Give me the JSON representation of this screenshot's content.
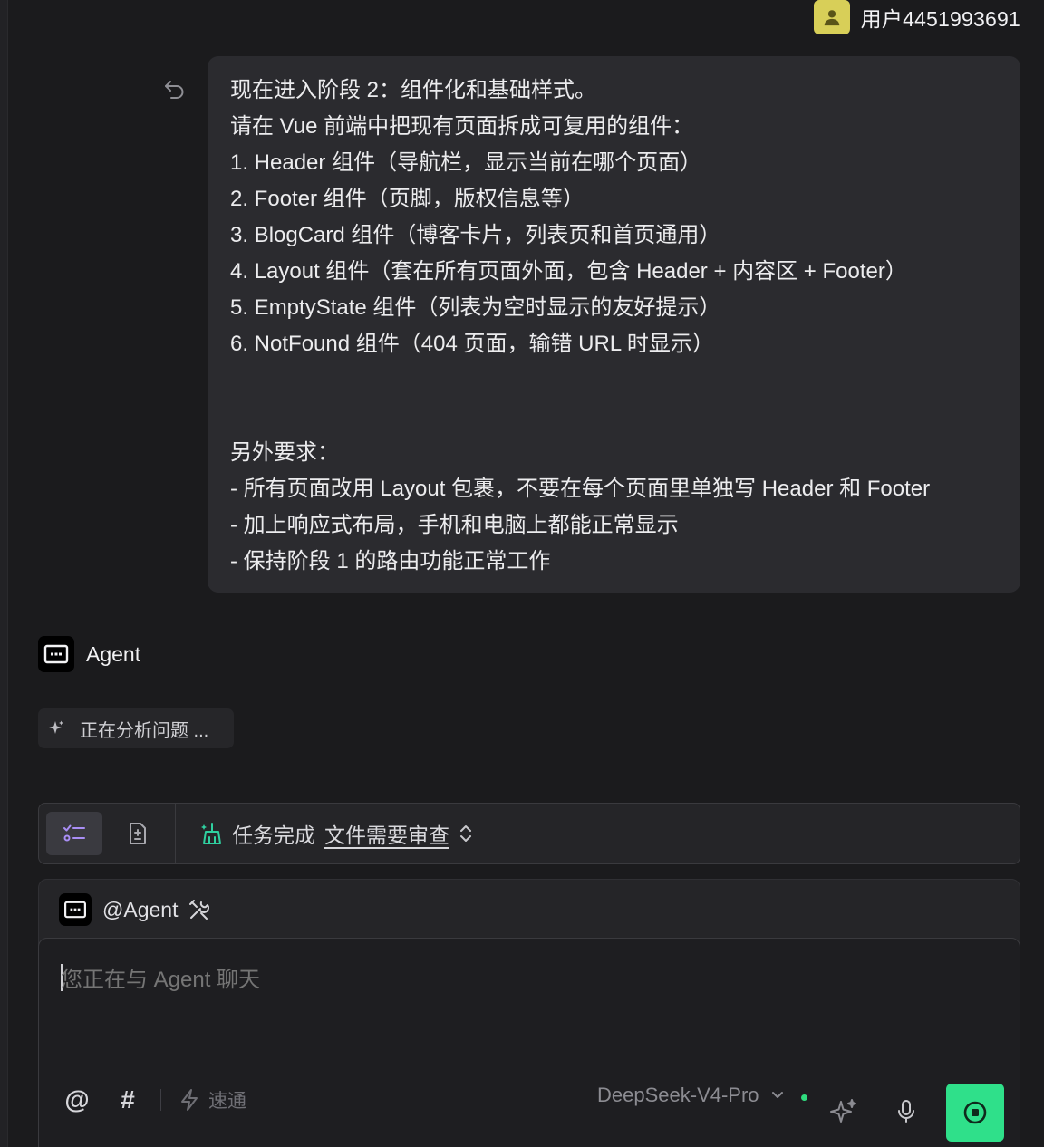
{
  "user": {
    "name": "用户4451993691"
  },
  "message": {
    "lines": [
      "现在进入阶段 2：组件化和基础样式。",
      "请在 Vue 前端中把现有页面拆成可复用的组件：",
      "1. Header 组件（导航栏，显示当前在哪个页面）",
      "2. Footer 组件（页脚，版权信息等）",
      "3. BlogCard 组件（博客卡片，列表页和首页通用）",
      "4. Layout 组件（套在所有页面外面，包含 Header + 内容区 + Footer）",
      "5. EmptyState 组件（列表为空时显示的友好提示）",
      "6. NotFound 组件（404 页面，输错 URL 时显示）",
      "",
      "",
      "另外要求：",
      "- 所有页面改用 Layout 包裹，不要在每个页面里单独写 Header 和 Footer",
      "- 加上响应式布局，手机和电脑上都能正常显示",
      "- 保持阶段 1 的路由功能正常工作"
    ]
  },
  "agent": {
    "name": "Agent",
    "status": "正在分析问题 ..."
  },
  "status_bar": {
    "label": "任务完成",
    "link": "文件需要审查"
  },
  "composer": {
    "mention": "@Agent",
    "placeholder": "您正在与 Agent 聊天",
    "quick_mode": "速通",
    "model": "DeepSeek-V4-Pro",
    "tool_at": "@",
    "tool_hash": "#"
  },
  "colors": {
    "accent_green": "#2fe08a",
    "status_teal": "#2fd0a0",
    "avatar_yellow": "#d8cf58",
    "active_tab_purple": "#a98ef5"
  }
}
